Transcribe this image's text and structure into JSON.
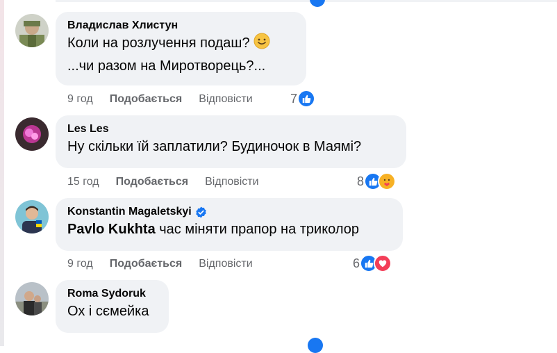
{
  "comments": [
    {
      "author": "Владислав Хлистун",
      "lines": [
        "Коли на розлучення подаш?",
        "...чи разом на Миротворець?..."
      ],
      "time": "9 год",
      "like_label": "Подобається",
      "reply_label": "Відповісти",
      "reaction_count": "7",
      "reactions": [
        "like-icon"
      ]
    },
    {
      "author": "Les Les",
      "lines": [
        "Ну скільки їй заплатили? Будиночок в Маямі?"
      ],
      "time": "15 год",
      "like_label": "Подобається",
      "reply_label": "Відповісти",
      "reaction_count": "8",
      "reactions": [
        "like-icon",
        "care-icon"
      ]
    },
    {
      "author": "Konstantin Magaletskyi",
      "verified": true,
      "mention": "Pavlo Kukhta",
      "lines": [
        "час міняти прапор на триколор"
      ],
      "time": "9 год",
      "like_label": "Подобається",
      "reply_label": "Відповісти",
      "reaction_count": "6",
      "reactions": [
        "like-icon",
        "love-icon"
      ]
    },
    {
      "author": "Roma Sydoruk",
      "lines": [
        "Ох і сємейка"
      ]
    }
  ],
  "colors": {
    "like": "#1877f2",
    "love": "#f33e58",
    "care": "#f7b125",
    "bubble": "#f0f2f5",
    "meta": "#65676b"
  }
}
